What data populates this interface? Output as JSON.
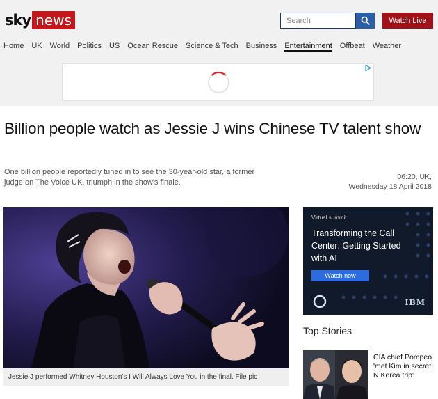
{
  "brand": {
    "sky": "sky",
    "news": "news"
  },
  "header": {
    "search_placeholder": "Search",
    "watch_live": "Watch Live"
  },
  "nav": {
    "items": [
      "Home",
      "UK",
      "World",
      "Politics",
      "US",
      "Ocean Rescue",
      "Science & Tech",
      "Business",
      "Entertainment",
      "Offbeat",
      "Weather"
    ],
    "active": "Entertainment"
  },
  "article": {
    "headline": "Billion people watch as Jessie J wins Chinese TV talent show",
    "standfirst": "One billion people reportedly tuned in to see the 30-year-old star, a former judge on The Voice UK, triumph in the show's finale.",
    "time": "06:20, UK,",
    "date": "Wednesday 18 April 2018",
    "image_caption": "Jessie J performed Whitney Houston's I Will Always Love You in the final. File pic"
  },
  "side_ad": {
    "kicker": "Virtual summit",
    "title": "Transforming the Call Center: Getting Started with AI",
    "cta": "Watch now",
    "brand": "IBM"
  },
  "top_stories": {
    "title": "Top Stories",
    "items": [
      {
        "text": "CIA chief Pompeo 'met Kim in secret N Korea trip'"
      }
    ]
  },
  "colors": {
    "brand_red": "#c4161c",
    "watch_live_red": "#a01217",
    "search_blue": "#2a5fa8",
    "ad_background": "#101a2b",
    "ad_cta_blue": "#2d6cdf"
  }
}
